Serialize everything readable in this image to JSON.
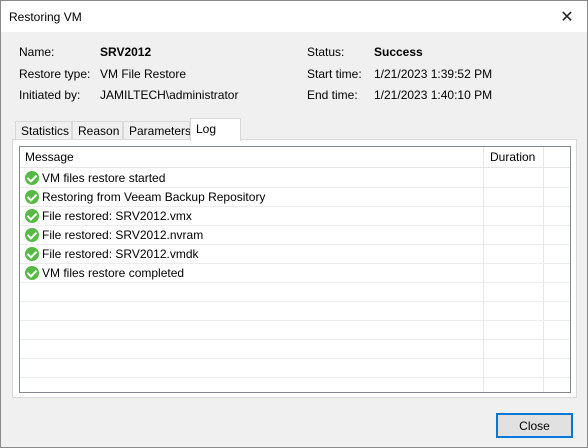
{
  "window": {
    "title": "Restoring VM"
  },
  "info": {
    "name_label": "Name:",
    "name_value": "SRV2012",
    "restore_type_label": "Restore type:",
    "restore_type_value": "VM File Restore",
    "initiated_label": "Initiated by:",
    "initiated_value": "JAMILTECH\\administrator",
    "status_label": "Status:",
    "status_value": "Success",
    "start_label": "Start time:",
    "start_value": "1/21/2023 1:39:52 PM",
    "end_label": "End time:",
    "end_value": "1/21/2023 1:40:10 PM"
  },
  "tabs": [
    {
      "label": "Statistics"
    },
    {
      "label": "Reason"
    },
    {
      "label": "Parameters"
    },
    {
      "label": "Log"
    }
  ],
  "active_tab": "Log",
  "log": {
    "columns": [
      "Message",
      "Duration"
    ],
    "rows": [
      {
        "status_icon": "success-check-icon",
        "message": "VM files restore started",
        "duration": ""
      },
      {
        "status_icon": "success-check-icon",
        "message": "Restoring from Veeam Backup Repository",
        "duration": ""
      },
      {
        "status_icon": "success-check-icon",
        "message": "File restored: SRV2012.vmx",
        "duration": ""
      },
      {
        "status_icon": "success-check-icon",
        "message": "File restored: SRV2012.nvram",
        "duration": ""
      },
      {
        "status_icon": "success-check-icon",
        "message": "File restored: SRV2012.vmdk",
        "duration": ""
      },
      {
        "status_icon": "success-check-icon",
        "message": "VM files restore completed",
        "duration": ""
      }
    ]
  },
  "buttons": {
    "close_label": "Close"
  },
  "colors": {
    "success_green": "#58b947",
    "focus_blue": "#0078d7"
  }
}
